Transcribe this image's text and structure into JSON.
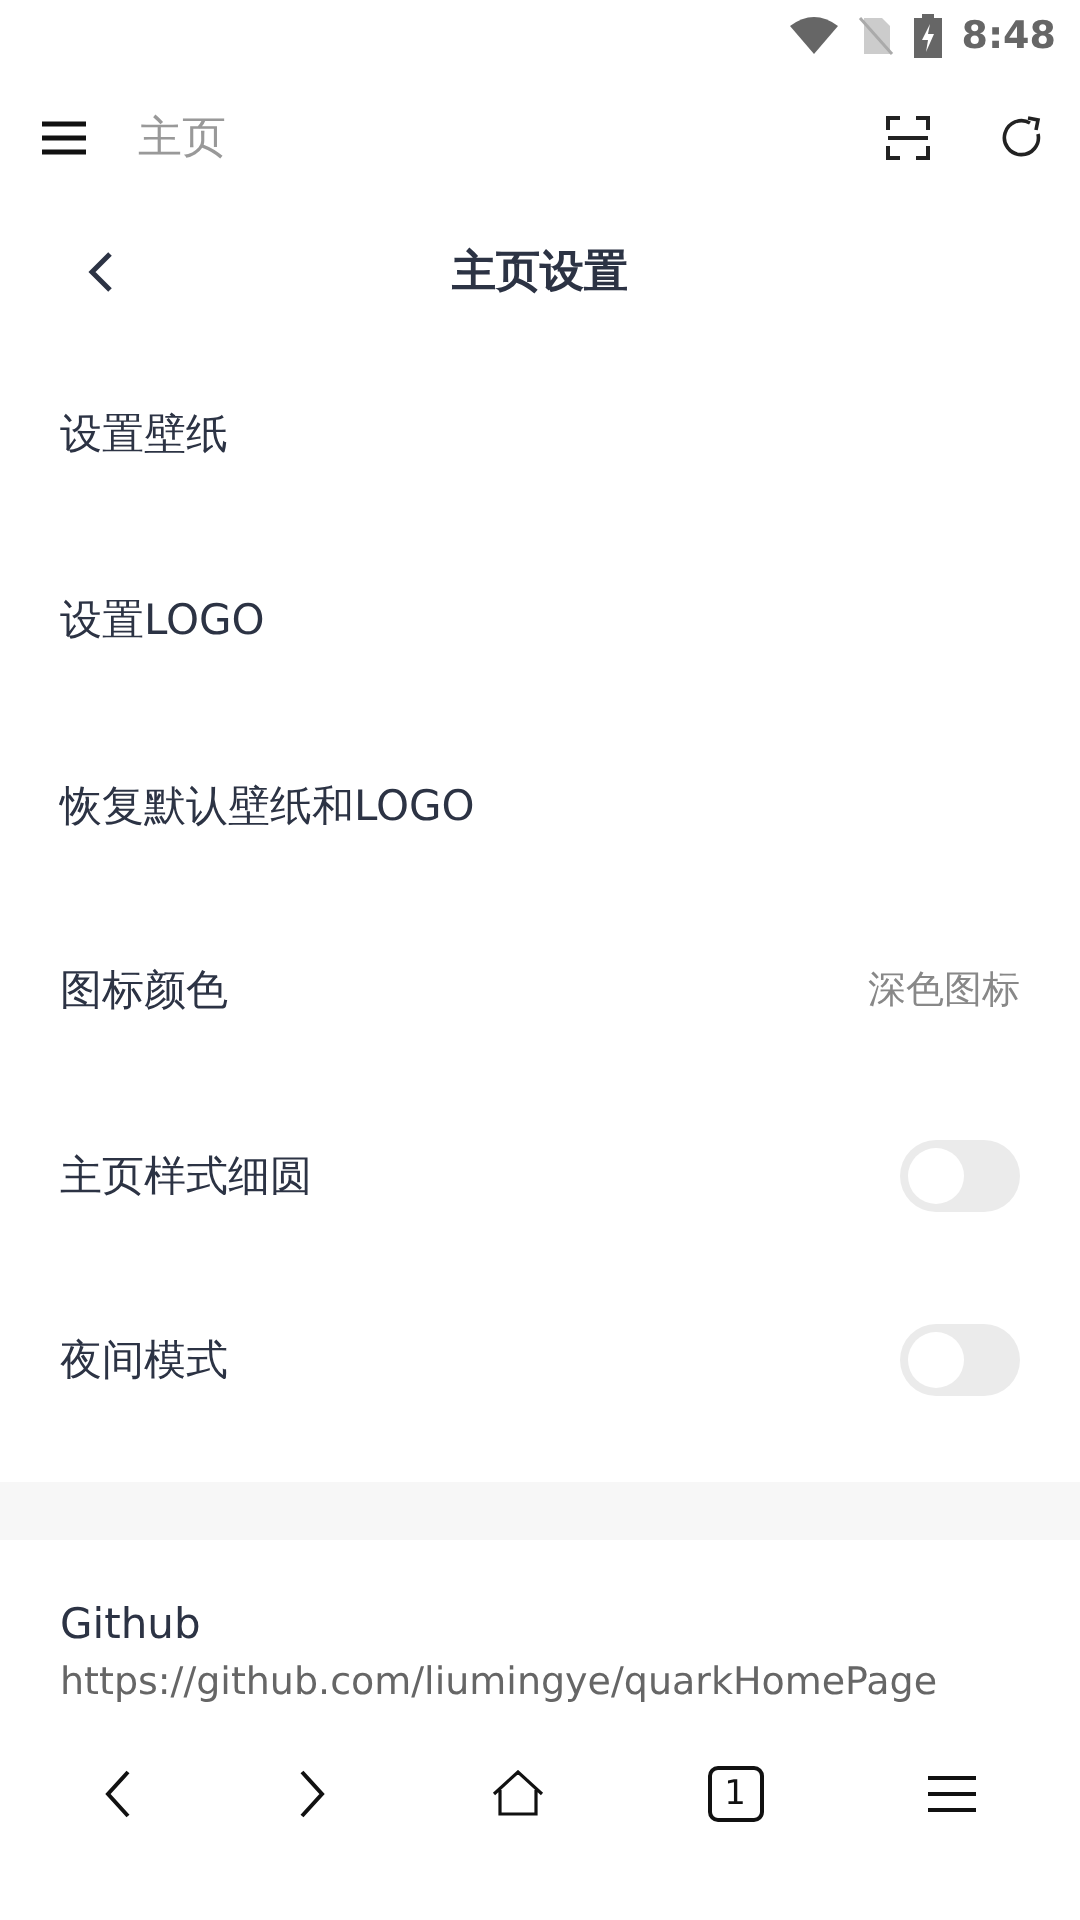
{
  "status_bar": {
    "time": "8:48"
  },
  "top_bar": {
    "title": "主页"
  },
  "header": {
    "title": "主页设置"
  },
  "settings": [
    {
      "kind": "link",
      "label": "设置壁纸"
    },
    {
      "kind": "link",
      "label": "设置LOGO"
    },
    {
      "kind": "link",
      "label": "恢复默认壁纸和LOGO"
    },
    {
      "kind": "value",
      "label": "图标颜色",
      "value": "深色图标"
    },
    {
      "kind": "toggle",
      "label": "主页样式细圆",
      "on": false
    },
    {
      "kind": "toggle",
      "label": "夜间模式",
      "on": false
    }
  ],
  "github": {
    "title": "Github",
    "url": "https://github.com/liumingye/quarkHomePage"
  },
  "bottom_bar": {
    "tab_count": "1"
  }
}
